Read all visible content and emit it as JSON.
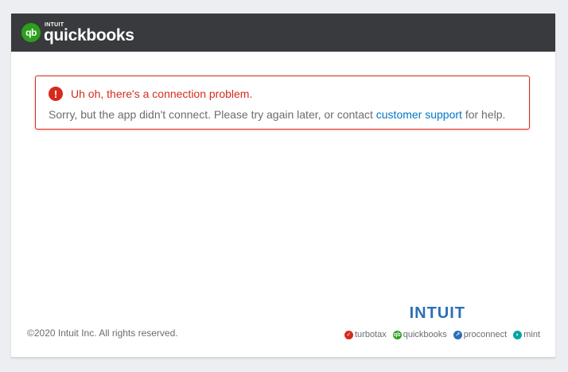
{
  "header": {
    "logo_intuit": "INTUIT",
    "logo_name": "quickbooks",
    "logo_mark": "qb"
  },
  "alert": {
    "title": "Uh oh, there's a connection problem.",
    "body_prefix": "Sorry, but the app didn't connect. Please try again later, or contact ",
    "link_text": "customer support",
    "body_suffix": " for help."
  },
  "footer": {
    "copyright": "©2020 Intuit Inc. All rights reserved.",
    "intuit_logo": "INTUIT",
    "brands": [
      {
        "label": "turbotax",
        "color": "#d52b1e"
      },
      {
        "label": "quickbooks",
        "color": "#2ca01c"
      },
      {
        "label": "proconnect",
        "color": "#2c6fb7"
      },
      {
        "label": "mint",
        "color": "#00a6a4"
      }
    ]
  },
  "colors": {
    "header_bg": "#393a3d",
    "error_red": "#d52b1e",
    "link_blue": "#0077c5",
    "qb_green": "#2ca01c"
  }
}
